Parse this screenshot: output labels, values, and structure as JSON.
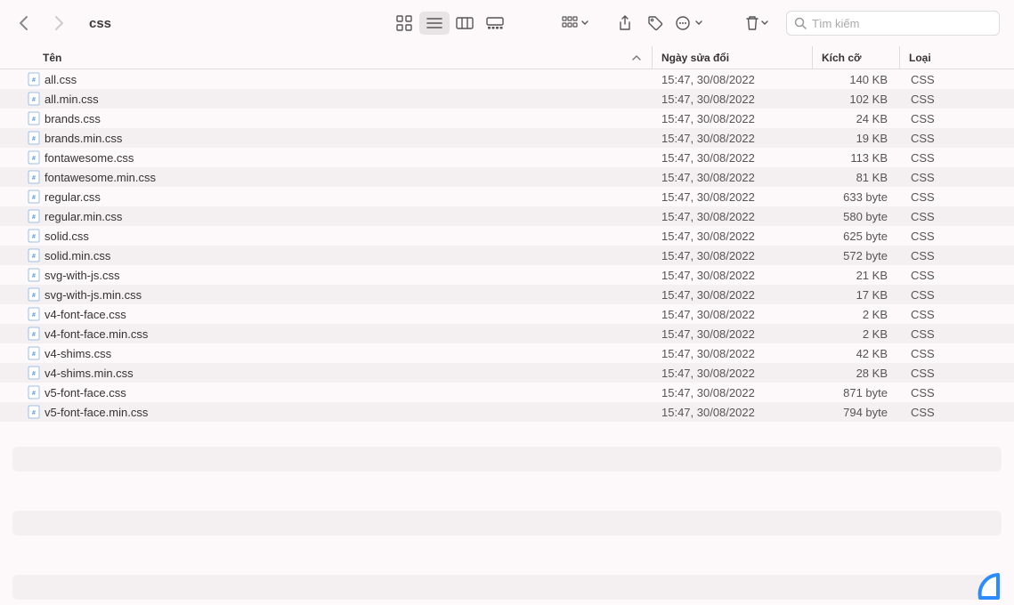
{
  "toolbar": {
    "title": "css",
    "search_placeholder": "Tìm kiếm"
  },
  "columns": {
    "name": "Tên",
    "date": "Ngày sửa đổi",
    "size": "Kích cỡ",
    "kind": "Loại"
  },
  "files": [
    {
      "name": "all.css",
      "date": "15:47, 30/08/2022",
      "size": "140 KB",
      "kind": "CSS"
    },
    {
      "name": "all.min.css",
      "date": "15:47, 30/08/2022",
      "size": "102 KB",
      "kind": "CSS"
    },
    {
      "name": "brands.css",
      "date": "15:47, 30/08/2022",
      "size": "24 KB",
      "kind": "CSS"
    },
    {
      "name": "brands.min.css",
      "date": "15:47, 30/08/2022",
      "size": "19 KB",
      "kind": "CSS"
    },
    {
      "name": "fontawesome.css",
      "date": "15:47, 30/08/2022",
      "size": "113 KB",
      "kind": "CSS"
    },
    {
      "name": "fontawesome.min.css",
      "date": "15:47, 30/08/2022",
      "size": "81 KB",
      "kind": "CSS"
    },
    {
      "name": "regular.css",
      "date": "15:47, 30/08/2022",
      "size": "633 byte",
      "kind": "CSS"
    },
    {
      "name": "regular.min.css",
      "date": "15:47, 30/08/2022",
      "size": "580 byte",
      "kind": "CSS"
    },
    {
      "name": "solid.css",
      "date": "15:47, 30/08/2022",
      "size": "625 byte",
      "kind": "CSS"
    },
    {
      "name": "solid.min.css",
      "date": "15:47, 30/08/2022",
      "size": "572 byte",
      "kind": "CSS"
    },
    {
      "name": "svg-with-js.css",
      "date": "15:47, 30/08/2022",
      "size": "21 KB",
      "kind": "CSS"
    },
    {
      "name": "svg-with-js.min.css",
      "date": "15:47, 30/08/2022",
      "size": "17 KB",
      "kind": "CSS"
    },
    {
      "name": "v4-font-face.css",
      "date": "15:47, 30/08/2022",
      "size": "2 KB",
      "kind": "CSS"
    },
    {
      "name": "v4-font-face.min.css",
      "date": "15:47, 30/08/2022",
      "size": "2 KB",
      "kind": "CSS"
    },
    {
      "name": "v4-shims.css",
      "date": "15:47, 30/08/2022",
      "size": "42 KB",
      "kind": "CSS"
    },
    {
      "name": "v4-shims.min.css",
      "date": "15:47, 30/08/2022",
      "size": "28 KB",
      "kind": "CSS"
    },
    {
      "name": "v5-font-face.css",
      "date": "15:47, 30/08/2022",
      "size": "871 byte",
      "kind": "CSS"
    },
    {
      "name": "v5-font-face.min.css",
      "date": "15:47, 30/08/2022",
      "size": "794 byte",
      "kind": "CSS"
    }
  ]
}
